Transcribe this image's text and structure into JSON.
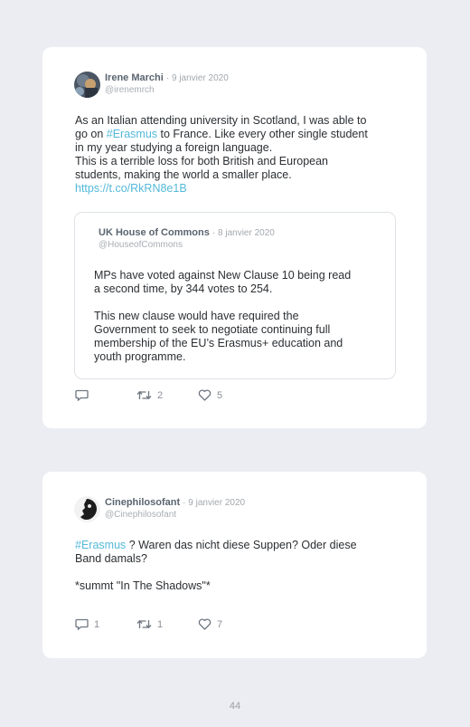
{
  "tweets": [
    {
      "author": "Irene Marchi",
      "date": "· 9 janvier 2020",
      "handle": "@irenemrch",
      "text_line1": "As an Italian attending university in Scotland, I was able to",
      "text_line2_pre": "go on ",
      "text_line2_hashtag": "#Erasmus",
      "text_line2_post": " to France. Like every other single student",
      "text_line3": "in my year studying a foreign language.",
      "text_line4": "This is a terrible loss for both British and European",
      "text_line5": "students, making the world a smaller place.",
      "link": "https://t.co/RkRN8e1B",
      "quote": {
        "author": "UK House of Commons",
        "date": "· 8 janvier 2020",
        "handle": "@HouseofCommons",
        "line1": "MPs have voted against New Clause 10 being read",
        "line2": "a second time, by 344 votes to 254.",
        "line3": "This new clause would have required the",
        "line4": "Government to seek to negotiate continuing full",
        "line5": "membership of the EU’s Erasmus+ education and",
        "line6": "youth programme."
      },
      "replies": "",
      "retweets": "2",
      "likes": "5"
    },
    {
      "author": "Cinephilosofant",
      "date": "· 9 janvier 2020",
      "handle": "@Cinephilosofant",
      "text_hashtag": "#Erasmus",
      "text_line1_post": " ? Waren das nicht diese Suppen? Oder diese",
      "text_line2": "Band damals?",
      "text_line3": "*summt \"In The Shadows\"*",
      "replies": "1",
      "retweets": "1",
      "likes": "7"
    }
  ],
  "page_number": "44",
  "icons": [
    "reply-icon",
    "retweet-icon",
    "like-icon"
  ],
  "colors": {
    "background": "#ecedf3",
    "card": "#ffffff",
    "link": "#54b9d9"
  }
}
